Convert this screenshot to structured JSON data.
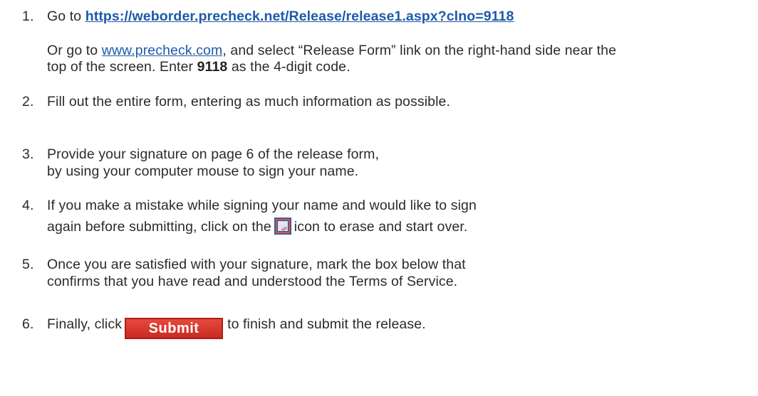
{
  "steps": {
    "s1": {
      "num": "1.",
      "text_before": "Go to ",
      "link": "https://weborder.precheck.net/Release/release1.aspx?clno=9118",
      "alt_prefix": "Or go to ",
      "alt_link": "www.precheck.com",
      "alt_suffix": ", and select “Release Form” link on the right-hand side near the",
      "alt_line2_before": "top of the screen.  Enter ",
      "code": "9118",
      "alt_line2_after": " as the 4-digit code."
    },
    "s2": {
      "num": "2.",
      "text": "Fill out the entire form, entering as much information as possible."
    },
    "s3": {
      "num": "3.",
      "line1": "Provide your signature on page 6 of the release form,",
      "line2": "by using your computer mouse to sign your name."
    },
    "s4": {
      "num": "4.",
      "line1": "If you make a mistake while signing your name and would like to sign",
      "line2_before": "again before submitting, click on the",
      "line2_after": "icon to erase and start over."
    },
    "s5": {
      "num": "5.",
      "line1": "Once you are satisfied with your signature, mark the box below that",
      "line2": "confirms that you have read and understood the Terms of Service."
    },
    "s6": {
      "num": "6.",
      "before": "Finally, click",
      "button_label": "Submit",
      "after": "to finish and submit the release."
    }
  },
  "icons": {
    "erase": "erase-signature-icon"
  },
  "colors": {
    "text": "#2b2b2b",
    "link": "#1e5aa8",
    "submit_button": "#d6372b"
  }
}
